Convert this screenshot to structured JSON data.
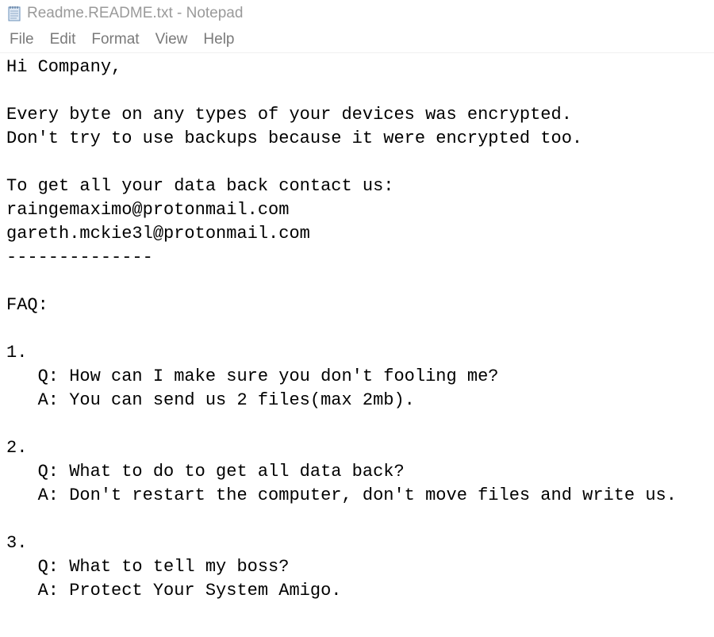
{
  "window": {
    "title": "Readme.README.txt - Notepad",
    "icon": "notepad-icon"
  },
  "menu": {
    "file": "File",
    "edit": "Edit",
    "format": "Format",
    "view": "View",
    "help": "Help"
  },
  "document": {
    "text": "Hi Company,\n\nEvery byte on any types of your devices was encrypted.\nDon't try to use backups because it were encrypted too.\n\nTo get all your data back contact us:\nraingemaximo@protonmail.com\ngareth.mckie3l@protonmail.com\n--------------\n\nFAQ:\n\n1.\n   Q: How can I make sure you don't fooling me?\n   A: You can send us 2 files(max 2mb).\n\n2.\n   Q: What to do to get all data back?\n   A: Don't restart the computer, don't move files and write us.\n\n3.\n   Q: What to tell my boss?\n   A: Protect Your System Amigo."
  }
}
